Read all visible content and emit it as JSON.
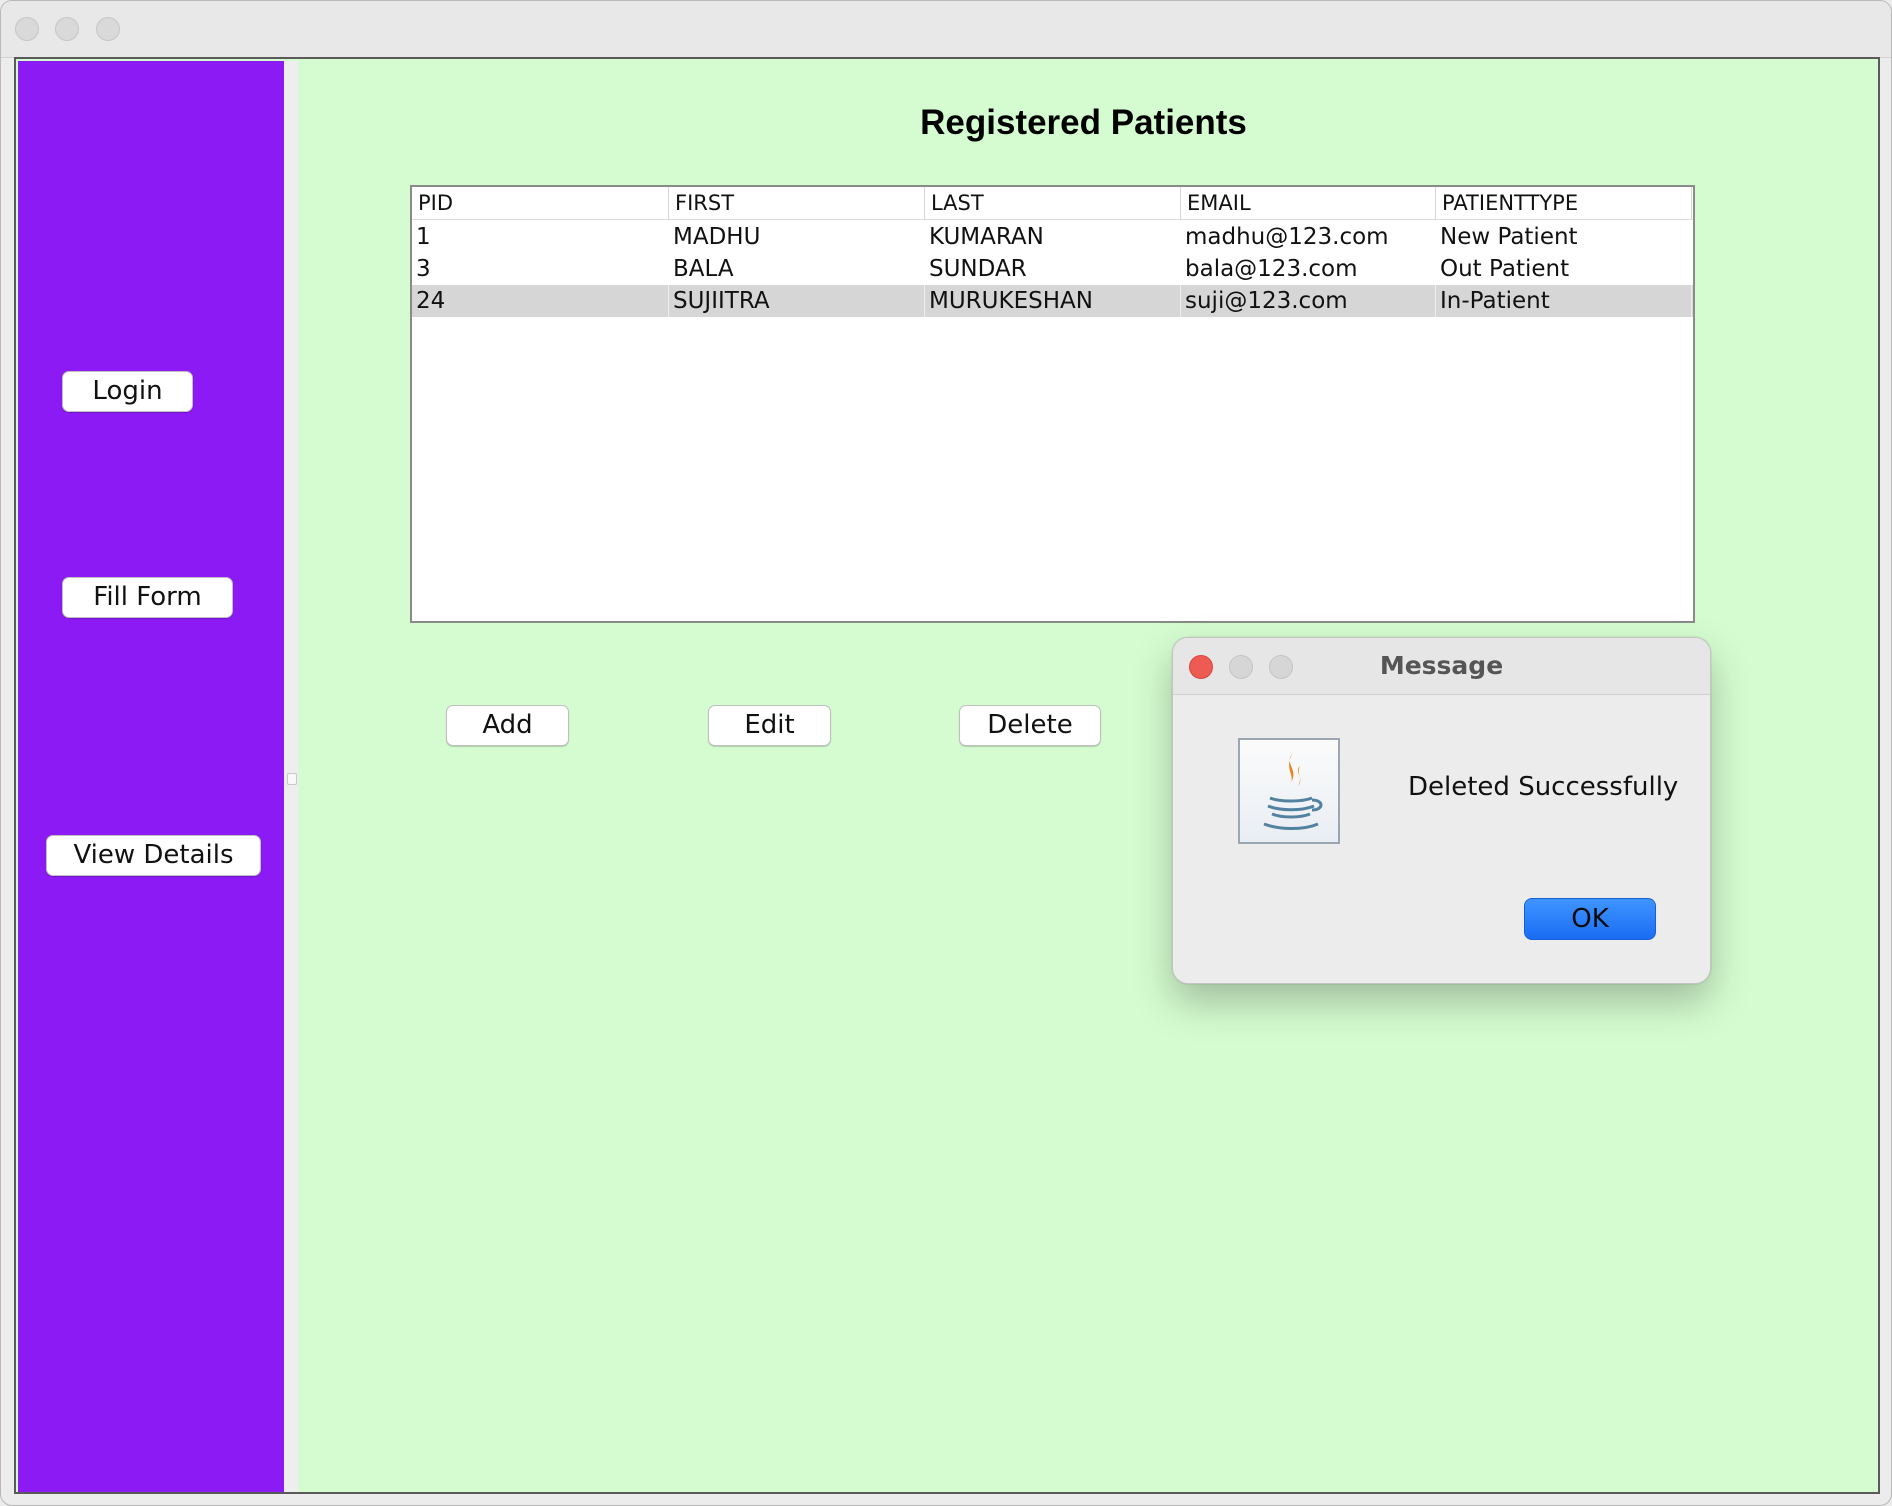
{
  "window": {
    "title": ""
  },
  "sidebar": {
    "login_label": "Login",
    "fill_form_label": "Fill Form",
    "view_details_label": "View Details",
    "color": "#8c1af5"
  },
  "main": {
    "title": "Registered Patients",
    "background": "#d5fcd0",
    "table": {
      "columns": [
        "PID",
        "FIRST",
        "LAST",
        "EMAIL",
        "PATIENTTYPE"
      ],
      "rows": [
        [
          "1",
          "MADHU",
          "KUMARAN",
          "madhu@123.com",
          "New Patient"
        ],
        [
          "3",
          "BALA",
          "SUNDAR",
          "bala@123.com",
          "Out Patient"
        ],
        [
          "24",
          "SUJIITRA",
          "MURUKESHAN",
          "suji@123.com",
          "In-Patient"
        ]
      ],
      "selected_row": 3
    },
    "actions": {
      "add_label": "Add",
      "edit_label": "Edit",
      "delete_label": "Delete"
    }
  },
  "dialog": {
    "title": "Message",
    "message": "Deleted Successfully",
    "ok_label": "OK",
    "icon": "java-coffee-cup-icon"
  }
}
